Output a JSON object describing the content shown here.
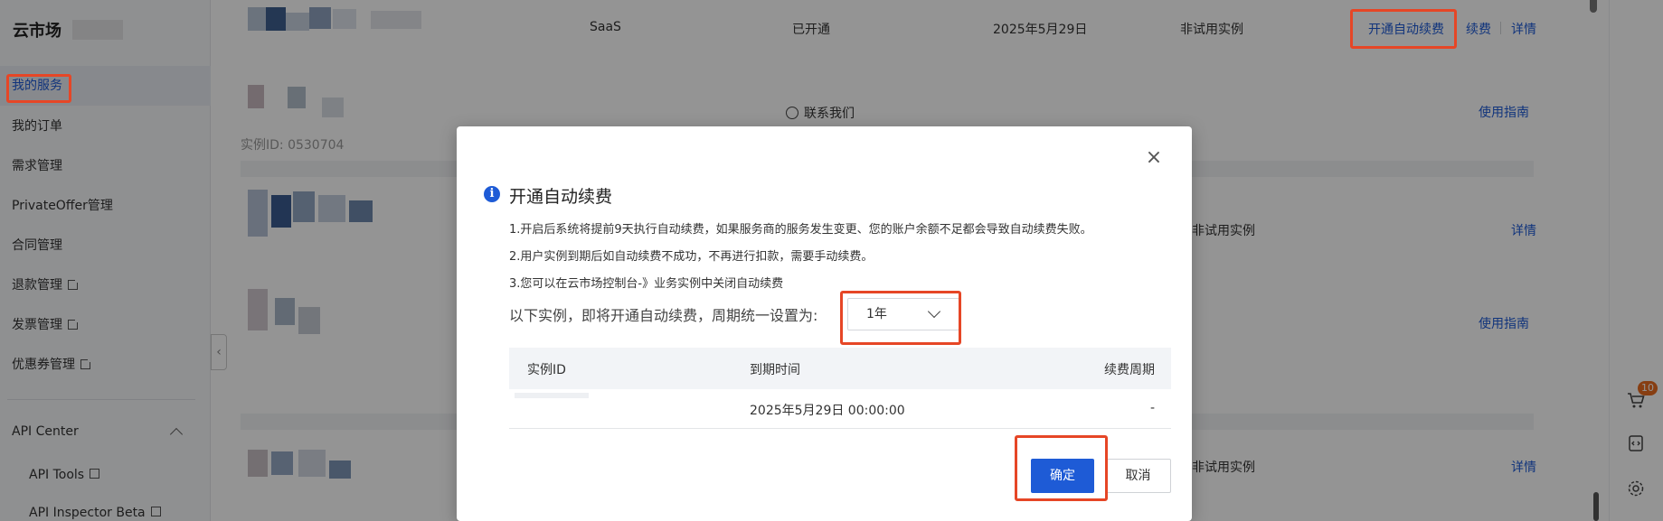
{
  "sidebar": {
    "brand": "云市场",
    "items": [
      {
        "label": "我的服务",
        "external": false,
        "active": true
      },
      {
        "label": "我的订单",
        "external": false
      },
      {
        "label": "需求管理",
        "external": false
      },
      {
        "label": "PrivateOffer管理",
        "external": false
      },
      {
        "label": "合同管理",
        "external": false
      },
      {
        "label": "退款管理",
        "external": true
      },
      {
        "label": "发票管理",
        "external": true
      },
      {
        "label": "优惠券管理",
        "external": true
      }
    ],
    "api_center": {
      "label": "API Center",
      "items": [
        {
          "label": "API Tools",
          "external": true
        },
        {
          "label": "API Inspector Beta",
          "external": true
        }
      ]
    }
  },
  "table": {
    "rows": [
      {
        "type": "SaaS",
        "status": "已开通",
        "expiry": "2025年5月29日",
        "trial": "非试用实例",
        "actions": [
          "开通自动续费",
          "续费",
          "详情"
        ]
      },
      {
        "contact": "联系我们",
        "guide": "使用指南",
        "id_fragment": "实例ID: 0530704"
      },
      {
        "trial": "非试用实例",
        "detail": "详情"
      },
      {
        "guide": "使用指南"
      },
      {
        "trial": "非试用实例",
        "detail": "详情"
      }
    ]
  },
  "right_toolbar": {
    "cart_badge": "10",
    "icons": [
      "cart-icon",
      "code-icon",
      "settings-icon"
    ]
  },
  "modal": {
    "title": "开通自动续费",
    "notices": [
      "1.开启后系统将提前9天执行自动续费，如果服务商的服务发生变更、您的账户余额不足都会导致自动续费失败。",
      "2.用户实例到期后如自动续费不成功，不再进行扣款，需要手动续费。",
      "3.您可以在云市场控制台-》业务实例中关闭自动续费"
    ],
    "period_label": "以下实例，即将开通自动续费，周期统一设置为:",
    "period_value": "1年",
    "table_headers": [
      "实例ID",
      "到期时间",
      "续费周期"
    ],
    "table_rows": [
      {
        "id": "",
        "expiry": "2025年5月29日 00:00:00",
        "cycle": "-"
      }
    ],
    "confirm": "确定",
    "cancel": "取消"
  },
  "colors": {
    "accent": "#1e5bd6",
    "highlight": "#e64626",
    "badge": "#e86b1f"
  }
}
